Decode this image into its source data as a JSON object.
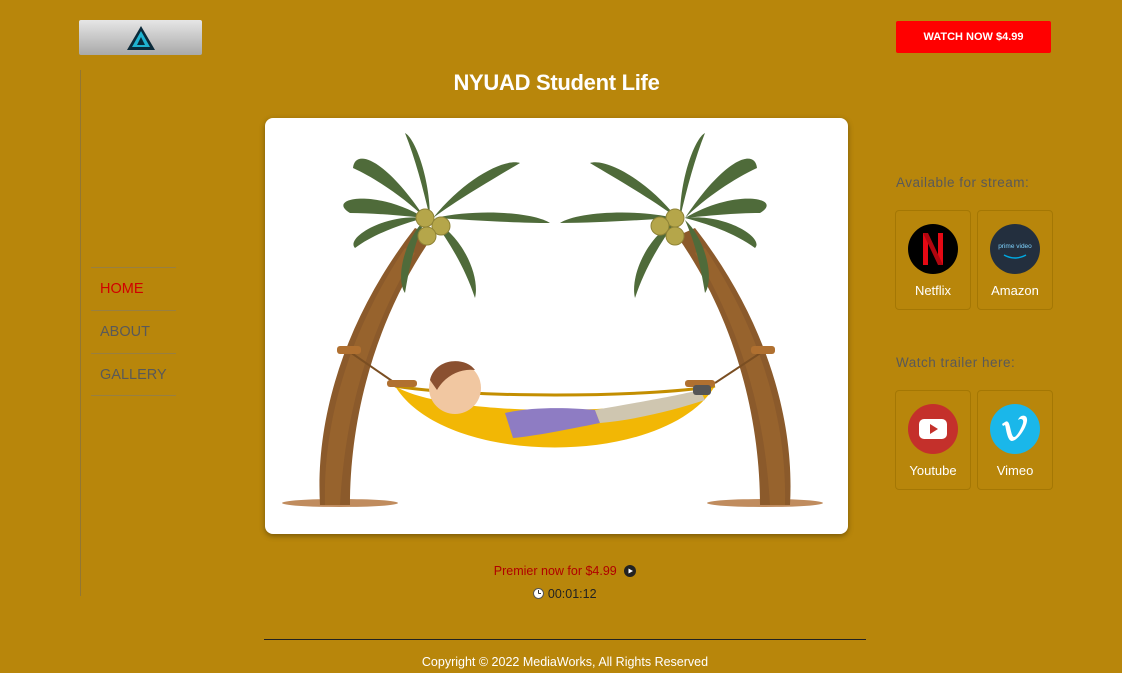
{
  "header": {
    "watch_now_label": "WATCH NOW $4.99"
  },
  "nav": {
    "items": [
      {
        "label": "HOME",
        "active": true
      },
      {
        "label": "ABOUT",
        "active": false
      },
      {
        "label": "GALLERY",
        "active": false
      }
    ]
  },
  "main": {
    "title": "NYUAD Student Life",
    "premier_text": "Premier now for $4.99",
    "duration": "00:01:12"
  },
  "sidebar": {
    "stream_label": "Available for stream:",
    "stream_services": [
      {
        "label": "Netflix",
        "icon": "netflix-icon"
      },
      {
        "label": "Amazon",
        "icon": "prime-video-icon"
      }
    ],
    "trailer_label": "Watch trailer here:",
    "trailer_services": [
      {
        "label": "Youtube",
        "icon": "youtube-icon"
      },
      {
        "label": "Vimeo",
        "icon": "vimeo-icon"
      }
    ],
    "prime_text": "prime video"
  },
  "footer": {
    "copyright": "Copyright © 2022 MediaWorks, All Rights Reserved"
  },
  "colors": {
    "background": "#b8860b",
    "accent": "#ff0000",
    "active_nav": "#d10000"
  }
}
